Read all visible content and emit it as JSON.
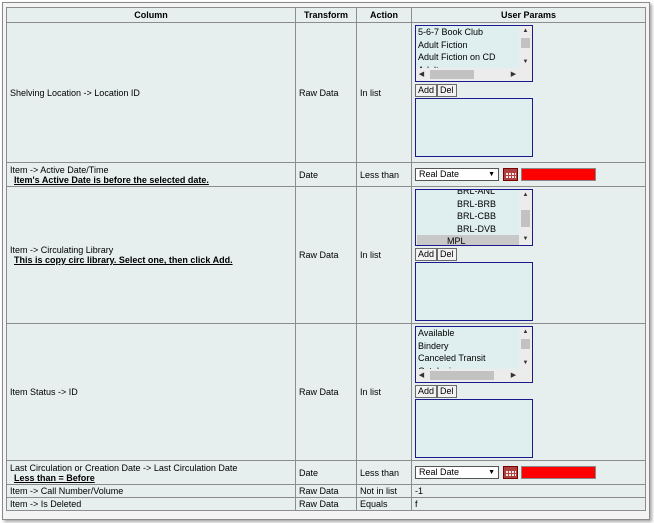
{
  "header": {
    "column": "Column",
    "transform": "Transform",
    "action": "Action",
    "user_params": "User Params"
  },
  "rows": [
    {
      "column": "Shelving Location -> Location ID",
      "transform": "Raw Data",
      "action": "In list",
      "list_options": [
        "5-6-7 Book Club",
        "Adult Fiction",
        "Adult Fiction on CD",
        "Adult ..."
      ],
      "add_label": "Add",
      "del_label": "Del"
    },
    {
      "column": "Item -> Active Date/Time",
      "hint": "Item's Active Date is before the selected date.",
      "transform": "Date",
      "action": "Less than",
      "date_select": "Real Date"
    },
    {
      "column": "Item -> Circulating Library",
      "hint": "This is copy circ library. Select one, then click Add.",
      "transform": "Raw Data",
      "action": "In list",
      "list_options": [
        "BRL-ANL",
        "BRL-BRB",
        "BRL-CBB",
        "BRL-DVB",
        "MPL"
      ],
      "selected_option": "MPL",
      "add_label": "Add",
      "del_label": "Del"
    },
    {
      "column": "Item Status -> ID",
      "transform": "Raw Data",
      "action": "In list",
      "list_options": [
        "Available",
        "Bindery",
        "Canceled Transit",
        "Cataloging"
      ],
      "add_label": "Add",
      "del_label": "Del"
    },
    {
      "column": "Last Circulation or Creation Date -> Last Circulation Date",
      "hint": "Less than = Before",
      "transform": "Date",
      "action": "Less than",
      "date_select": "Real Date"
    },
    {
      "column": "Item -> Call Number/Volume",
      "transform": "Raw Data",
      "action": "Not in list",
      "param": "-1"
    },
    {
      "column": "Item -> Is Deleted",
      "transform": "Raw Data",
      "action": "Equals",
      "param": "f"
    }
  ],
  "colors": {
    "cell_bg": "#e6eeee",
    "list_border": "#1a1a8c",
    "red_field": "#ff0000"
  },
  "icons": [
    "calendar-icon",
    "scroll-up-icon",
    "scroll-down-icon",
    "scroll-left-icon",
    "scroll-right-icon",
    "dropdown-caret-icon"
  ]
}
